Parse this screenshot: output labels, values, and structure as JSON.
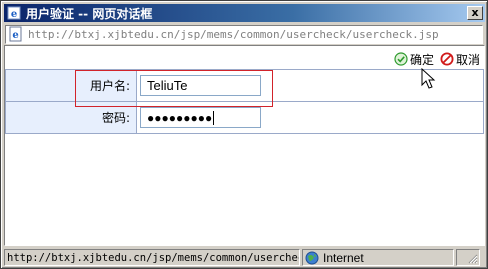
{
  "window": {
    "title": "用户验证 -- 网页对话框",
    "close_label": "x"
  },
  "address": {
    "url": "http://btxj.xjbtedu.cn/jsp/mems/common/usercheck/usercheck.jsp"
  },
  "toolbar": {
    "ok_label": "确定",
    "cancel_label": "取消"
  },
  "form": {
    "username_label": "用户名:",
    "username_value": "TeliuTe",
    "password_label": "密码:",
    "password_value": "●●●●●●●●●"
  },
  "statusbar": {
    "url": "http://btxj.xjbtedu.cn/jsp/mems/common/usercheck/",
    "zone": "Internet"
  },
  "colors": {
    "title_gradient_start": "#0a246a",
    "highlight": "#d2232a",
    "label_bg": "#e7effd",
    "ok_icon": "#2e9a2e",
    "cancel_icon": "#d11a1a"
  }
}
